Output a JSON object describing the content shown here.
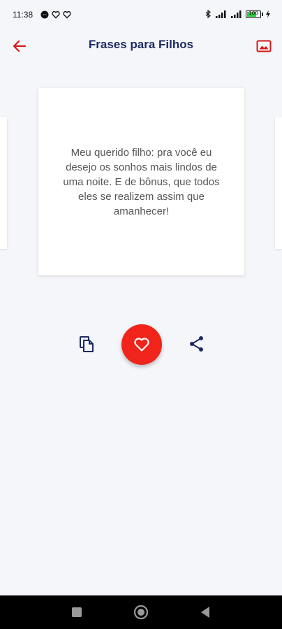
{
  "status_bar": {
    "time": "11:38",
    "battery": "100"
  },
  "app_bar": {
    "title": "Frases para Filhos",
    "back_icon": "arrow-left-icon",
    "image_icon": "image-icon"
  },
  "card": {
    "text": "Meu querido filho: pra você eu desejo os sonhos mais lindos de uma noite. E de bônus, que todos eles se realizem assim que amanhecer!"
  },
  "actions": {
    "copy_icon": "copy-icon",
    "favorite_icon": "heart-icon",
    "share_icon": "share-icon"
  },
  "colors": {
    "accent": "#f0241a",
    "title": "#1d2a63",
    "background": "#f5f6fa"
  }
}
